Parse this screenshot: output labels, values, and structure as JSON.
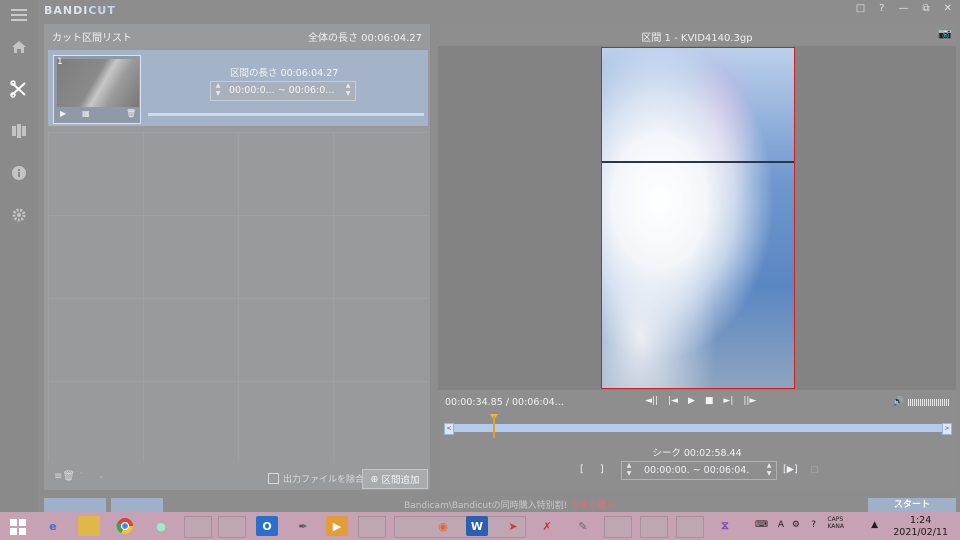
{
  "app": {
    "logo_main": "BANDI",
    "logo_accent": "CUT",
    "window_controls": [
      "folder-icon",
      "help-icon",
      "minimize-icon",
      "restore-icon",
      "close-icon"
    ]
  },
  "sidebar": {
    "items": [
      {
        "name": "home-icon",
        "active": false
      },
      {
        "name": "cut-icon",
        "active": true
      },
      {
        "name": "join-icon",
        "active": false
      },
      {
        "name": "info-icon",
        "active": false
      },
      {
        "name": "settings-icon",
        "active": false
      }
    ]
  },
  "cut_list": {
    "title": "カット区間リスト",
    "total_length": "全体の長さ 00:06:04.27",
    "segments": [
      {
        "index": "1",
        "length": "区間の長さ 00:06:04.27",
        "range": "00:00:0... ~ 00:06:0...",
        "progress": 1.0
      }
    ],
    "exclude_output_label": "出力ファイルを除合",
    "add_segment_label": "区間追加"
  },
  "preview": {
    "title": "区間 1 - KVID4140.3gp",
    "time_display": "00:00:34.85 / 00:06:04...",
    "playhead_fraction": 0.096,
    "seek_label": "シーク 00:02:58.44",
    "range_text": "00:00:00.  ~  00:06:04."
  },
  "footer": {
    "notice": "Bandicam\\Bandicutの同時購入特別割!",
    "notice_highlight": "今すぐ購入",
    "start_label": "スタート"
  },
  "taskbar": {
    "running_text": "Bandicam\\Bandicutの同時購入特別割!",
    "time": "1:24",
    "date": "2021/02/11"
  },
  "colors": {
    "accent": "#a9c3ea",
    "playhead": "#f0b43c",
    "video_border": "#d42020",
    "taskbar": "#c7a2b4"
  }
}
